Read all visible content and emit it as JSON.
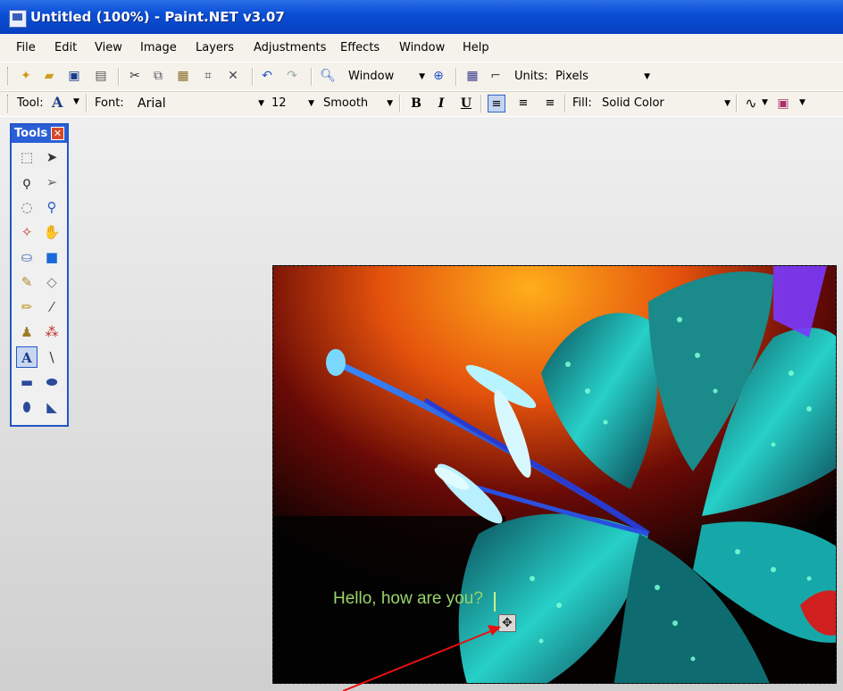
{
  "window": {
    "title": "Untitled (100%) - Paint.NET v3.07"
  },
  "menu": [
    "File",
    "Edit",
    "View",
    "Image",
    "Layers",
    "Adjustments",
    "Effects",
    "Window",
    "Help"
  ],
  "toolbar": {
    "zoom_select": "Window",
    "units_label": "Units:",
    "units_value": "Pixels"
  },
  "text_toolbar": {
    "tool_label": "Tool:",
    "tool_glyph": "A",
    "font_label": "Font:",
    "font_value": "Arial",
    "size_value": "12",
    "smoothing_value": "Smooth",
    "bold": "B",
    "italic": "I",
    "underline": "U",
    "fill_label": "Fill:",
    "fill_value": "Solid Color"
  },
  "tools_window": {
    "title": "Tools",
    "close_glyph": "✕",
    "selected_tool_glyph": "A"
  },
  "canvas": {
    "text": "Hello, how are you?"
  },
  "colors": {
    "titlebar": "#0a4fd6",
    "chrome": "#f4f2ea",
    "annotation_arrow": "#e81010",
    "canvas_text": "#9ad46a"
  }
}
